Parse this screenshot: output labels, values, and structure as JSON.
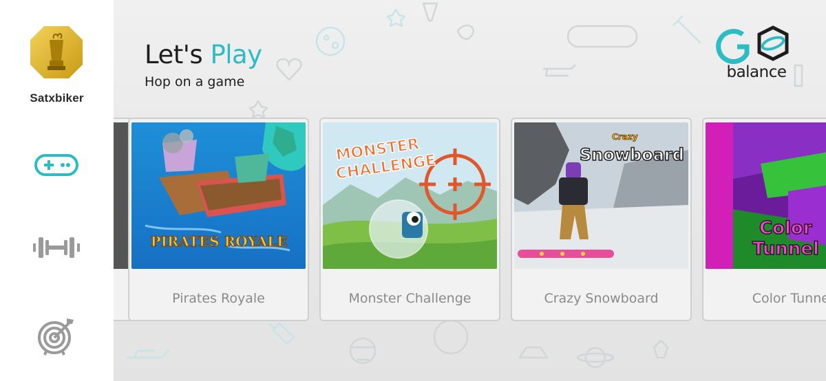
{
  "user": {
    "name": "Satxbiker",
    "avatar_icon": "trophy-avatar-icon"
  },
  "nav": [
    {
      "id": "games",
      "icon": "gamepad-icon",
      "active": true
    },
    {
      "id": "fitness",
      "icon": "dumbbell-icon",
      "active": false
    },
    {
      "id": "goals",
      "icon": "target-icon",
      "active": false
    }
  ],
  "header": {
    "title_prefix": "Let's",
    "title_accent": "Play",
    "subtitle": "Hop on a game"
  },
  "brand": {
    "logo_text": "balance",
    "accent_color": "#2bbcc5"
  },
  "games": [
    {
      "title": "Pirates Royale",
      "art_text": "PIRATES ROYALE"
    },
    {
      "title": "Monster Challenge",
      "art_text": [
        "MONSTER",
        "CHALLENGE"
      ]
    },
    {
      "title": "Crazy Snowboard",
      "art_text": [
        "Crazy",
        "Snowboard"
      ]
    },
    {
      "title": "Color Tunnel",
      "art_text": [
        "Color",
        "Tunnel"
      ]
    }
  ]
}
